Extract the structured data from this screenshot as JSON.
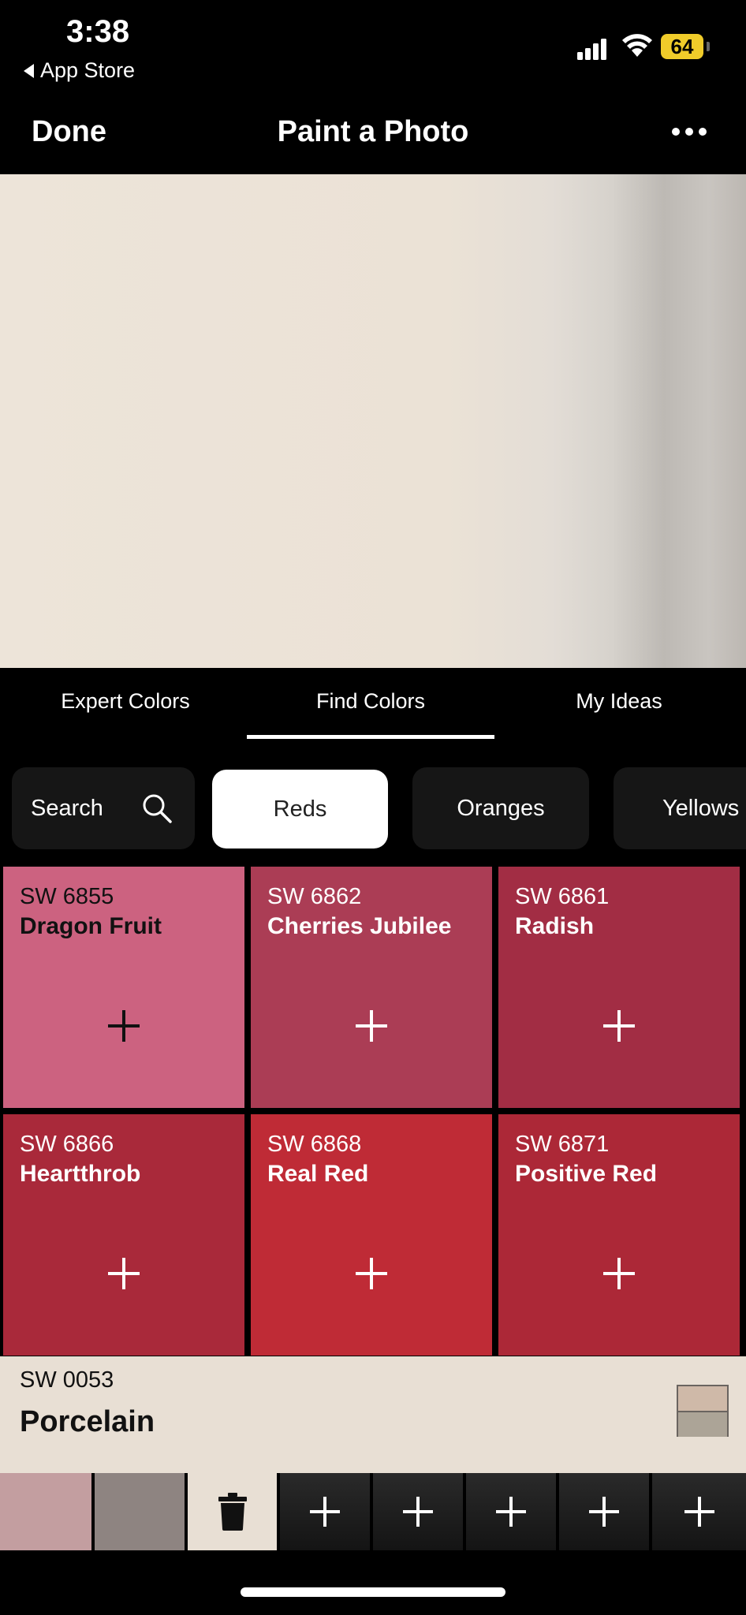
{
  "status_bar": {
    "time": "3:38",
    "back_label": "App Store",
    "battery": "64"
  },
  "nav": {
    "done": "Done",
    "title": "Paint a Photo"
  },
  "tabs": [
    {
      "label": "Expert Colors"
    },
    {
      "label": "Find Colors"
    },
    {
      "label": "My Ideas"
    }
  ],
  "chips": {
    "search": "Search",
    "items": [
      {
        "label": "Reds"
      },
      {
        "label": "Oranges"
      },
      {
        "label": "Yellows"
      }
    ]
  },
  "colors": [
    {
      "code": "SW 6855",
      "name": "Dragon Fruit",
      "hex": "#cc6280",
      "icon": "plus-icon"
    },
    {
      "code": "SW 6862",
      "name": "Cherries Jubilee",
      "hex": "#ab3d55",
      "icon": "plus-icon"
    },
    {
      "code": "SW 6861",
      "name": "Radish",
      "hex": "#a22d44",
      "icon": "plus-icon"
    },
    {
      "code": "SW 6866",
      "name": "Heartthrob",
      "hex": "#a9293a",
      "icon": "plus-icon"
    },
    {
      "code": "SW 6868",
      "name": "Real Red",
      "hex": "#bf2b36",
      "icon": "plus-icon"
    },
    {
      "code": "SW 6871",
      "name": "Positive Red",
      "hex": "#ac2837",
      "icon": "plus-icon"
    }
  ],
  "selected": {
    "code": "SW 0053",
    "name": "Porcelain",
    "hex": "#e8dfd4"
  },
  "palette": [
    {
      "type": "color",
      "hex": "#c39ea0"
    },
    {
      "type": "color",
      "hex": "#8e8481"
    },
    {
      "type": "active",
      "icon": "trash-icon"
    },
    {
      "type": "empty",
      "icon": "plus-icon"
    },
    {
      "type": "empty",
      "icon": "plus-icon"
    },
    {
      "type": "empty",
      "icon": "plus-icon"
    },
    {
      "type": "empty",
      "icon": "plus-icon"
    },
    {
      "type": "empty",
      "icon": "plus-icon"
    }
  ]
}
